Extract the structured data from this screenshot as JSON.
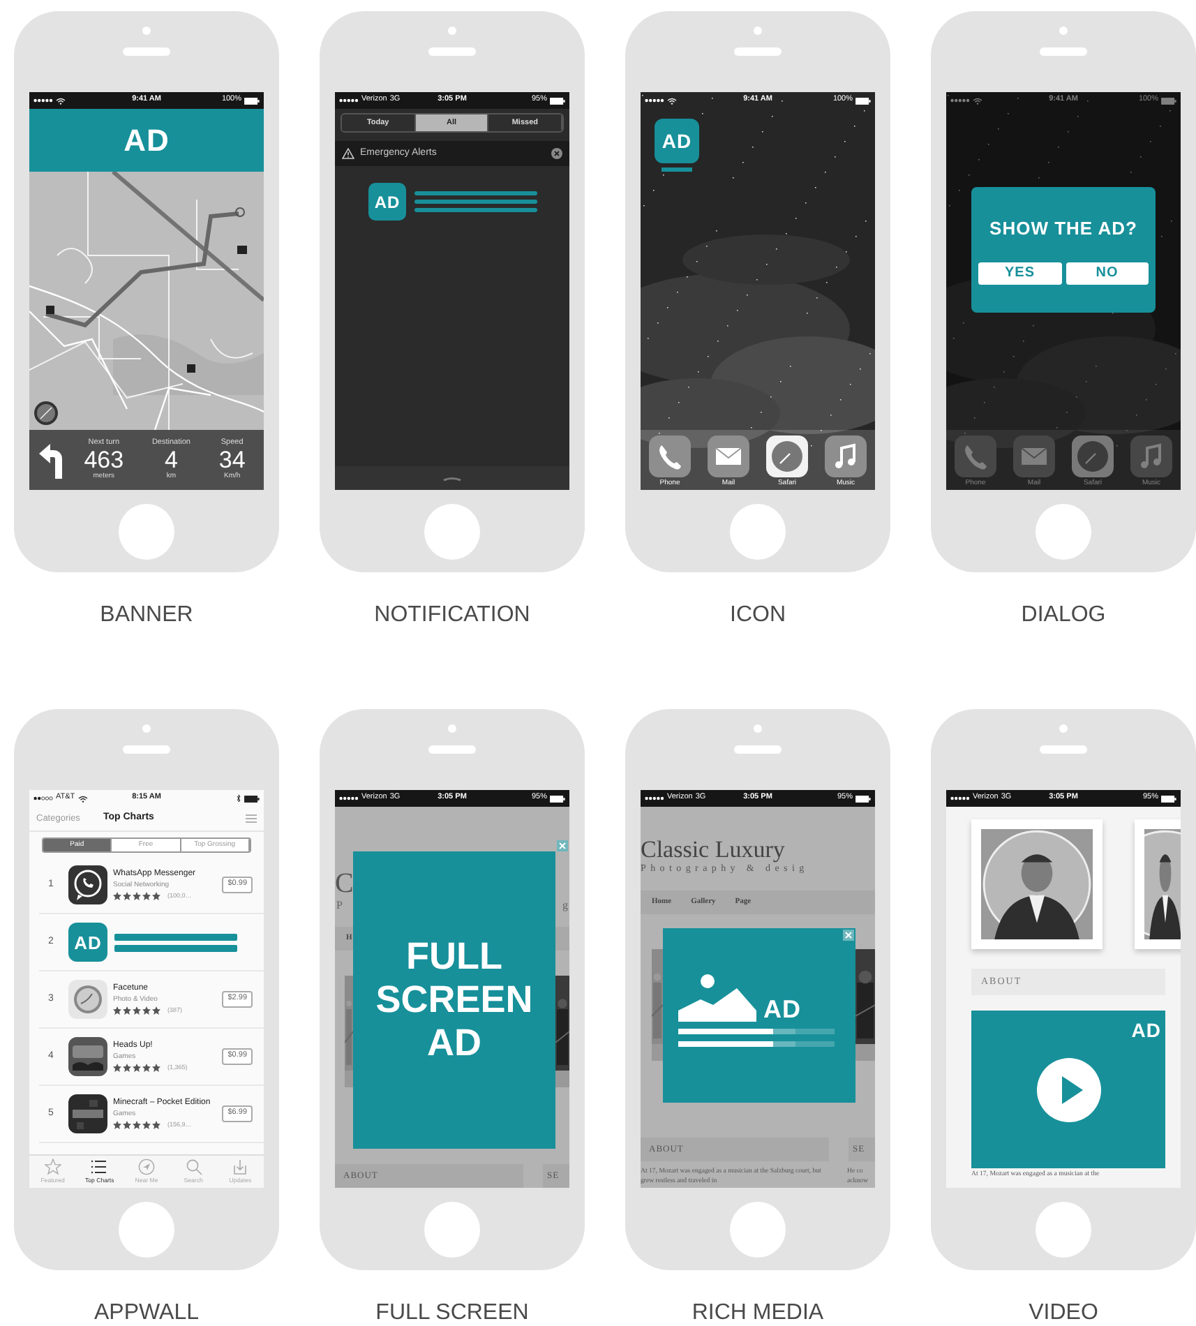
{
  "phones": [
    {
      "kind": "banner",
      "label": "BANNER",
      "status": {
        "time": "9:41 AM",
        "battery": "100%"
      },
      "ad": {
        "text": "AD"
      },
      "navigation": [
        {
          "caption": "Next turn",
          "value": "463",
          "unit": "meters"
        },
        {
          "caption": "Destination",
          "value": "4",
          "unit": "km"
        },
        {
          "caption": "Speed",
          "value": "34",
          "unit": "Km/h"
        }
      ]
    },
    {
      "kind": "notification",
      "label": "NOTIFICATION",
      "status": {
        "carrier": "Verizon",
        "network": "3G",
        "time": "3:05 PM",
        "battery": "95%"
      },
      "tabs": [
        {
          "label": "Today",
          "selected": false
        },
        {
          "label": "All",
          "selected": true
        },
        {
          "label": "Missed",
          "selected": false
        }
      ],
      "section": "Emergency Alerts",
      "ad": {
        "text": "AD"
      }
    },
    {
      "kind": "icon",
      "label": "ICON",
      "status": {
        "time": "9:41 AM",
        "battery": "100%"
      },
      "ad": {
        "text": "AD"
      },
      "dock": [
        "Phone",
        "Mail",
        "Safari",
        "Music"
      ]
    },
    {
      "kind": "dialog",
      "label": "DIALOG",
      "status": {
        "time": "9:41 AM",
        "battery": "100%"
      },
      "dialog": {
        "title": "SHOW THE AD?",
        "buttons": [
          "YES",
          "NO"
        ]
      },
      "dock": [
        "Phone",
        "Mail",
        "Safari",
        "Music"
      ]
    },
    {
      "kind": "appwall",
      "label": "APPWALL",
      "status": {
        "carrier": "AT&T",
        "time": "8:15 AM"
      },
      "nav": {
        "back": "Categories",
        "title": "Top Charts"
      },
      "segments": [
        {
          "label": "Paid",
          "selected": true
        },
        {
          "label": "Free",
          "selected": false
        },
        {
          "label": "Top Grossing",
          "selected": false
        }
      ],
      "apps": [
        {
          "kind": "app",
          "rank": "1",
          "name": "WhatsApp Messenger",
          "category": "Social Networking",
          "stars": 5,
          "count": "(100,0…",
          "price": "$0.99"
        },
        {
          "kind": "ad",
          "rank": "2",
          "text": "AD"
        },
        {
          "kind": "app",
          "rank": "3",
          "name": "Facetune",
          "category": "Photo & Video",
          "stars": 5,
          "count": "(387)",
          "price": "$2.99"
        },
        {
          "kind": "app",
          "rank": "4",
          "name": "Heads Up!",
          "category": "Games",
          "stars": 5,
          "count": "(1,365)",
          "price": "$0.99"
        },
        {
          "kind": "app",
          "rank": "5",
          "name": "Minecraft – Pocket Edition",
          "category": "Games",
          "stars": 5,
          "count": "(156,9…",
          "price": "$6.99"
        }
      ],
      "tab_bar": [
        {
          "label": "Featured",
          "selected": false
        },
        {
          "label": "Top Charts",
          "selected": true
        },
        {
          "label": "Near Me",
          "selected": false
        },
        {
          "label": "Search",
          "selected": false
        },
        {
          "label": "Updates",
          "selected": false
        }
      ]
    },
    {
      "kind": "fullscreen",
      "label": "FULL SCREEN",
      "status": {
        "carrier": "Verizon",
        "network": "3G",
        "time": "3:05 PM",
        "battery": "95%"
      },
      "site": {
        "title": "C",
        "subtitle": [
          "P",
          "g"
        ],
        "nav": [
          "H"
        ],
        "sections": [
          "ABOUT",
          "SE"
        ]
      },
      "ad": {
        "text": "FULL SCREEN AD"
      }
    },
    {
      "kind": "richmedia",
      "label": "RICH MEDIA",
      "status": {
        "carrier": "Verizon",
        "network": "3G",
        "time": "3:05 PM",
        "battery": "95%"
      },
      "site": {
        "title": "Classic Luxury",
        "subtitle": [
          "Photography & desig"
        ],
        "nav": [
          "Home",
          "Gallery",
          "Page"
        ],
        "sections": [
          "ABOUT",
          "SE"
        ],
        "paragraphs": [
          "At 17, Mozart was engaged as a musician at the Salzburg court, but grew restless and traveled in",
          "He co acknow"
        ]
      },
      "ad": {
        "text": "AD",
        "bars": [
          {
            "level": 0.61
          },
          {
            "level": 0.61
          }
        ]
      }
    },
    {
      "kind": "video",
      "label": "VIDEO",
      "status": {
        "carrier": "Verizon",
        "network": "3G",
        "time": "3:05 PM",
        "battery": "95%"
      },
      "site": {
        "sections": [
          "ABOUT"
        ],
        "paragraphs": [
          "At 17, Mozart was engaged as a musician at the"
        ]
      },
      "ad": {
        "text": "AD"
      }
    }
  ]
}
